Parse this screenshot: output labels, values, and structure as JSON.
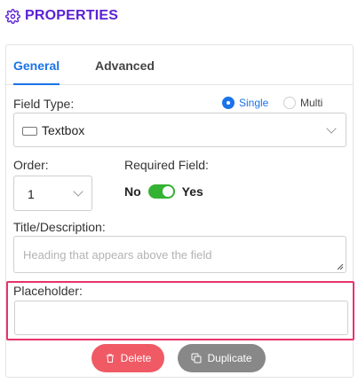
{
  "header": {
    "title": "PROPERTIES",
    "icon": "gear-icon"
  },
  "tabs": [
    {
      "label": "General",
      "active": true
    },
    {
      "label": "Advanced",
      "active": false
    }
  ],
  "field_type": {
    "label": "Field Type:",
    "value": "Textbox",
    "options": [
      {
        "label": "Single",
        "checked": true
      },
      {
        "label": "Multi",
        "checked": false
      }
    ]
  },
  "order": {
    "label": "Order:",
    "value": "1"
  },
  "required": {
    "label": "Required Field:",
    "off_label": "No",
    "on_label": "Yes",
    "on": true
  },
  "title_desc": {
    "label": "Title/Description:",
    "placeholder": "Heading that appears above the field"
  },
  "placeholder": {
    "label": "Placeholder:",
    "value": ""
  },
  "actions": {
    "delete_label": "Delete",
    "duplicate_label": "Duplicate"
  },
  "colors": {
    "header": "#5b21d6",
    "accent": "#1a73e8",
    "toggle_on": "#34b233",
    "delete": "#ef5a65",
    "duplicate": "#888888",
    "highlight": "#e8336b"
  }
}
